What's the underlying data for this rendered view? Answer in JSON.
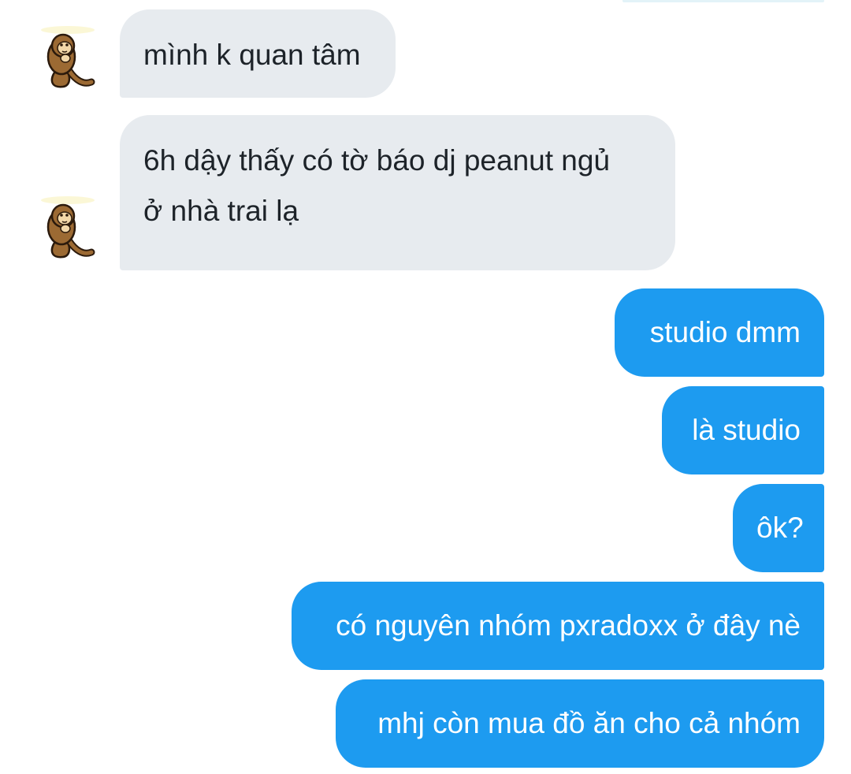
{
  "conversation": {
    "incoming": [
      {
        "lines": [
          "mình k quan tâm"
        ],
        "avatar_icon": "monkey-sticker-avatar-icon"
      },
      {
        "lines": [
          "6h dậy thấy có tờ báo dj peanut ngủ",
          "ở nhà trai lạ"
        ],
        "avatar_icon": "monkey-sticker-avatar-icon"
      }
    ],
    "outgoing": [
      {
        "text": "studio dmm"
      },
      {
        "text": "là studio"
      },
      {
        "text": "ôk?"
      },
      {
        "text": "có nguyên nhóm pxradoxx ở đây nè"
      },
      {
        "text": "mhj còn mua đồ ăn cho cả nhóm"
      }
    ]
  },
  "colors": {
    "incoming_bubble": "#e7ebef",
    "incoming_text": "#1d2329",
    "outgoing_bubble": "#1d9bf0",
    "outgoing_text": "#ffffff",
    "background": "#ffffff"
  }
}
